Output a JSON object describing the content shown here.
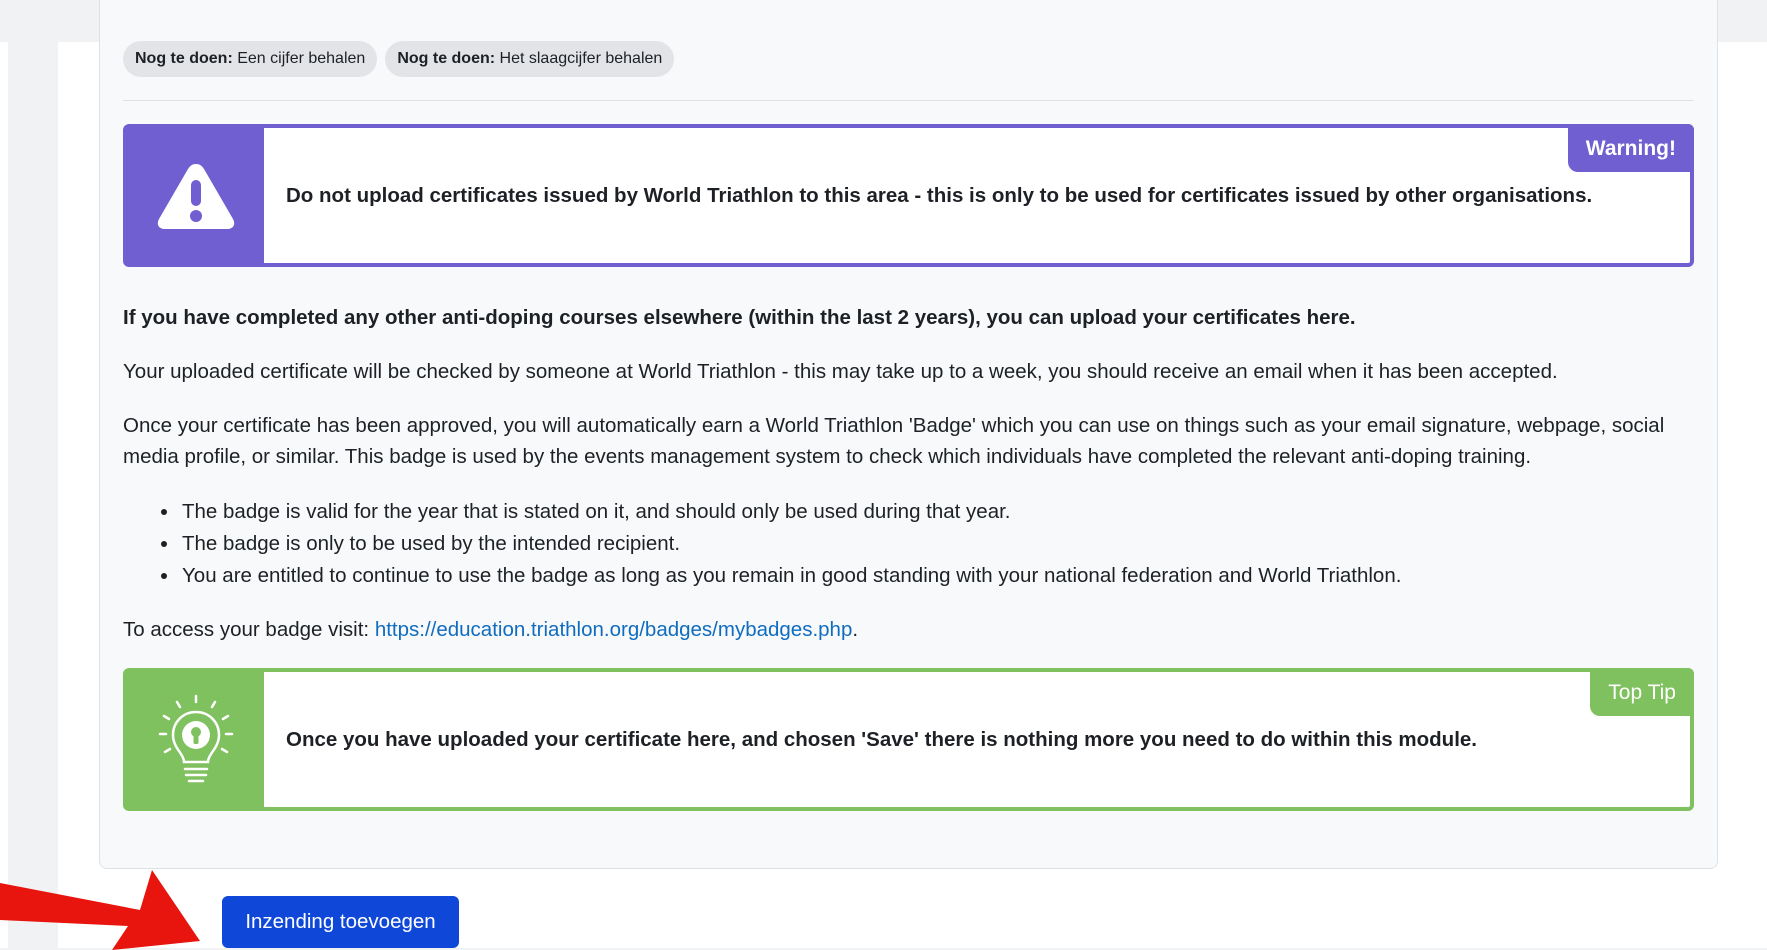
{
  "completion_chips": [
    {
      "label": "Nog te doen:",
      "value": "Een cijfer behalen"
    },
    {
      "label": "Nog te doen:",
      "value": "Het slaagcijfer behalen"
    }
  ],
  "warning_callout": {
    "tag": "Warning!",
    "message": "Do not upload certificates issued by World Triathlon to this area - this is only to be used for certificates issued by other organisations.",
    "icon": "warning-triangle-icon",
    "color": "#6f5fd0"
  },
  "content": {
    "intro_bold": "If you have completed any other anti-doping courses elsewhere (within the last 2 years), you can upload your certificates here.",
    "paragraph1": "Your uploaded certificate will be checked by someone at World Triathlon - this may take up to a week, you should receive an email when it has been accepted.",
    "paragraph2": "Once your certificate has been approved, you will automatically earn a World Triathlon 'Badge' which you can use on things such as your email signature, webpage, social media profile, or similar. This badge is used by the events management system to check which individuals have completed the relevant anti-doping training.",
    "bullets": [
      "The badge is valid for the year that is stated on it, and should only be used during that year.",
      "The badge is only to be used by the intended recipient.",
      "You are entitled to continue to use the badge as long as you remain in good standing with your national federation and World Triathlon."
    ],
    "access_prefix": "To access your badge visit: ",
    "access_link": "https://education.triathlon.org/badges/mybadges.php",
    "access_suffix": "."
  },
  "tip_callout": {
    "tag": "Top Tip",
    "message": "Once you have uploaded your certificate here, and chosen 'Save' there is nothing more you need to do within this module.",
    "icon": "lightbulb-icon",
    "color": "#7fc15e"
  },
  "submit_button": {
    "label": "Inzending toevoegen",
    "color": "#0f47d9"
  },
  "annotation_arrow": {
    "icon": "red-arrow-icon",
    "color": "#e8140e"
  }
}
